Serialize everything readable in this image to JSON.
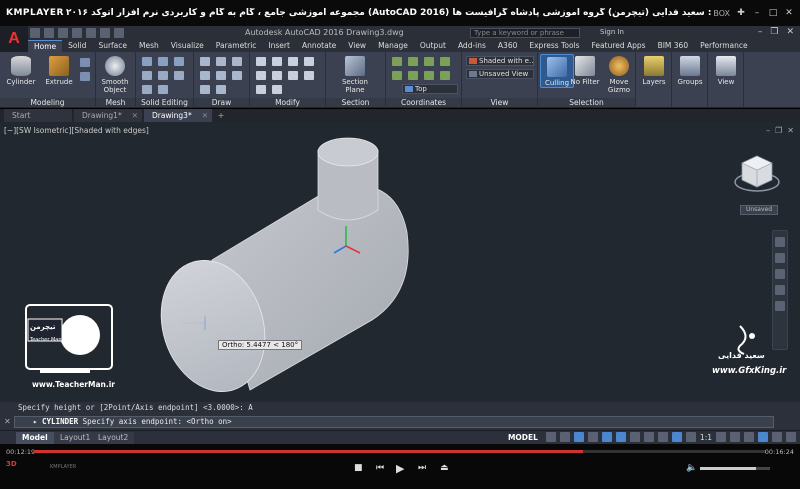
{
  "player": {
    "logo": "KMPLAYER",
    "title": "مجموعه آموزشی جامع ، گام به گام و کاربردی نرم افزار  اتوکد ۲۰۱۶ (AutoCAD 2016)  مدرس : سعید فدایی (تیچرمن) گروه آموزشی پادشاه گرافیست ها",
    "top_right_label": "BOX",
    "time_elapsed": "00:12:19",
    "time_total": "00:16:24",
    "progress": 0.75,
    "volume": 0.8,
    "badge": "3D",
    "mini_label": "KMPLAYER"
  },
  "acad": {
    "doc_title": "Autodesk AutoCAD 2016    Drawing3.dwg",
    "search_placeholder": "Type a keyword or phrase",
    "signin": "Sign In"
  },
  "ribbon_tabs": [
    {
      "label": "Home",
      "active": true
    },
    {
      "label": "Solid"
    },
    {
      "label": "Surface"
    },
    {
      "label": "Mesh"
    },
    {
      "label": "Visualize"
    },
    {
      "label": "Parametric"
    },
    {
      "label": "Insert"
    },
    {
      "label": "Annotate"
    },
    {
      "label": "View"
    },
    {
      "label": "Manage"
    },
    {
      "label": "Output"
    },
    {
      "label": "Add-ins"
    },
    {
      "label": "A360"
    },
    {
      "label": "Express Tools"
    },
    {
      "label": "Featured Apps"
    },
    {
      "label": "BIM 360"
    },
    {
      "label": "Performance"
    }
  ],
  "ribbon": {
    "cylinder": "Cylinder",
    "extrude": "Extrude",
    "smooth_object": "Smooth Object",
    "section_plane": "Section Plane",
    "culling": "Culling",
    "no_filter": "No Filter",
    "move_gizmo": "Move Gizmo",
    "layers": "Layers",
    "groups": "Groups",
    "view": "View",
    "visual_style": "Shaded with e...",
    "view_state": "Unsaved View",
    "ucs_view": "Top",
    "panels": {
      "modeling": "Modeling",
      "mesh": "Mesh",
      "solid_editing": "Solid Editing",
      "draw": "Draw",
      "modify": "Modify",
      "section": "Section",
      "coordinates": "Coordinates",
      "view": "View",
      "selection": "Selection"
    }
  },
  "file_tabs": [
    {
      "label": "Start"
    },
    {
      "label": "Drawing1*"
    },
    {
      "label": "Drawing3*",
      "active": true
    }
  ],
  "viewport": {
    "label": "[−][SW Isometric][Shaded with edges]",
    "unsaved": "Unsaved",
    "ortho_tip": "Ortho: 5.4477 < 180°"
  },
  "watermark": {
    "left_url": "www.TeacherMan.ir",
    "left_brand": "تیچرمن",
    "left_brand_en": "Teacher Man",
    "right_name": "سعید فدایی",
    "right_url": "www.GfxKing.ir"
  },
  "command": {
    "history": "Specify height or [2Point/Axis endpoint] <3.0000>: A",
    "name": "CYLINDER",
    "prompt": "Specify axis endpoint:  <Ortho on>"
  },
  "layout_tabs": [
    {
      "label": "Model",
      "active": true
    },
    {
      "label": "Layout1"
    },
    {
      "label": "Layout2"
    }
  ],
  "status": {
    "model": "MODEL",
    "scale": "1:1"
  },
  "colors": {
    "ribbon_bg": "#3b4150",
    "viewport_bg": "#212830",
    "accent": "#4a87cf",
    "seek": "#cc3333"
  }
}
